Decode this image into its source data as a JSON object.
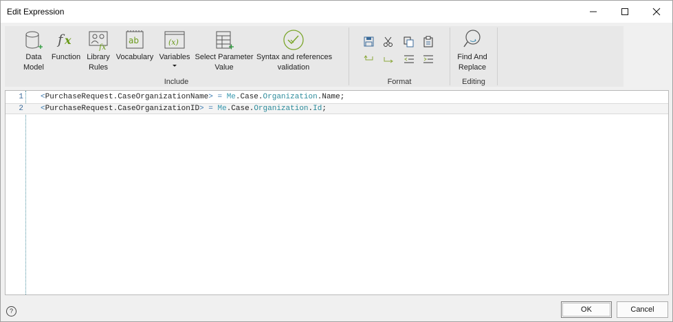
{
  "window": {
    "title": "Edit Expression"
  },
  "controls": {
    "minimize": "minimize",
    "maximize": "maximize",
    "close": "close"
  },
  "ribbon": {
    "include": {
      "label": "Include",
      "buttons": [
        {
          "label": "Data\nModel",
          "icon": "database-icon"
        },
        {
          "label": "Function",
          "icon": "function-icon"
        },
        {
          "label": "Library\nRules",
          "icon": "library-rules-icon"
        },
        {
          "label": "Vocabulary",
          "icon": "vocabulary-icon"
        },
        {
          "label": "Variables",
          "icon": "variables-icon"
        },
        {
          "label": "Select Parameter\nValue",
          "icon": "select-parameter-icon"
        },
        {
          "label": "Syntax and references\nvalidation",
          "icon": "validation-check-icon"
        }
      ]
    },
    "format": {
      "label": "Format",
      "icons": [
        "save-icon",
        "cut-icon",
        "copy-icon",
        "paste-icon",
        "undo-icon",
        "redo-icon",
        "outdent-icon",
        "indent-icon"
      ]
    },
    "editing": {
      "label": "Editing",
      "buttons": [
        {
          "label": "Find And\nReplace",
          "icon": "find-replace-icon"
        }
      ]
    }
  },
  "editor": {
    "lines": [
      {
        "num": "1",
        "lhs": "PurchaseRequest.CaseOrganizationName",
        "rhs_me": "Me",
        "rhs_case": "Case",
        "rhs_org": "Organization",
        "rhs_prop": "Name"
      },
      {
        "num": "2",
        "lhs": "PurchaseRequest.CaseOrganizationID",
        "rhs_me": "Me",
        "rhs_case": "Case",
        "rhs_org": "Organization",
        "rhs_prop": "Id"
      }
    ]
  },
  "footer": {
    "help": "?",
    "ok": "OK",
    "cancel": "Cancel"
  }
}
